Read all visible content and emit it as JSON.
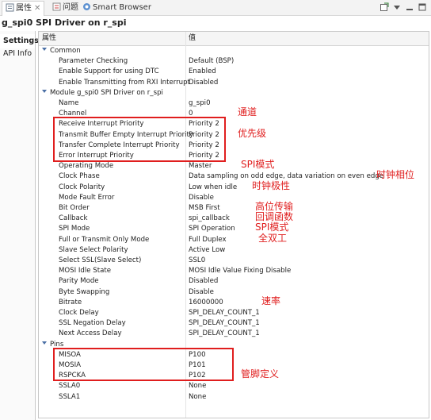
{
  "tabs": [
    {
      "label": "属性",
      "icon": "properties-icon"
    },
    {
      "label": "问题",
      "icon": "problems-icon"
    },
    {
      "label": "Smart Browser",
      "icon": "smart-browser-icon"
    }
  ],
  "title": "g_spi0 SPI Driver on r_spi",
  "side_tabs": [
    "Settings",
    "API Info"
  ],
  "columns": {
    "property": "属性",
    "value": "值"
  },
  "rows": [
    {
      "type": "group",
      "k": "Common"
    },
    {
      "k": "Parameter Checking",
      "v": "Default (BSP)"
    },
    {
      "k": "Enable Support for using DTC",
      "v": "Enabled"
    },
    {
      "k": "Enable Transmitting from RXI Interrupt",
      "v": "Disabled"
    },
    {
      "type": "group",
      "k": "Module g_spi0 SPI Driver on r_spi"
    },
    {
      "k": "Name",
      "v": "g_spi0"
    },
    {
      "k": "Channel",
      "v": "0"
    },
    {
      "k": "Receive Interrupt Priority",
      "v": "Priority 2"
    },
    {
      "k": "Transmit Buffer Empty Interrupt Priority",
      "v": "Priority 2"
    },
    {
      "k": "Transfer Complete Interrupt Priority",
      "v": "Priority 2"
    },
    {
      "k": "Error Interrupt Priority",
      "v": "Priority 2"
    },
    {
      "k": "Operating Mode",
      "v": "Master"
    },
    {
      "k": "Clock Phase",
      "v": "Data sampling on odd edge, data variation on even edge"
    },
    {
      "k": "Clock Polarity",
      "v": "Low when idle"
    },
    {
      "k": "Mode Fault Error",
      "v": "Disable"
    },
    {
      "k": "Bit Order",
      "v": "MSB First"
    },
    {
      "k": "Callback",
      "v": "spi_callback"
    },
    {
      "k": "SPI Mode",
      "v": "SPI Operation"
    },
    {
      "k": "Full or Transmit Only Mode",
      "v": "Full Duplex"
    },
    {
      "k": "Slave Select Polarity",
      "v": "Active Low"
    },
    {
      "k": "Select SSL(Slave Select)",
      "v": "SSL0"
    },
    {
      "k": "MOSI Idle State",
      "v": "MOSI Idle Value Fixing Disable"
    },
    {
      "k": "Parity Mode",
      "v": "Disabled"
    },
    {
      "k": "Byte Swapping",
      "v": "Disable"
    },
    {
      "k": "Bitrate",
      "v": "16000000"
    },
    {
      "k": "Clock Delay",
      "v": "SPI_DELAY_COUNT_1"
    },
    {
      "k": "SSL Negation Delay",
      "v": "SPI_DELAY_COUNT_1"
    },
    {
      "k": "Next Access Delay",
      "v": "SPI_DELAY_COUNT_1"
    },
    {
      "type": "group",
      "k": "Pins"
    },
    {
      "k": "MISOA",
      "v": "P100"
    },
    {
      "k": "MOSIA",
      "v": "P101"
    },
    {
      "k": "RSPCKA",
      "v": "P102"
    },
    {
      "k": "SSLA0",
      "v": "None"
    },
    {
      "k": "SSLA1",
      "v": "None"
    }
  ],
  "annotations": [
    {
      "text": "通道",
      "row": 6
    },
    {
      "text": "优先级",
      "row": 8
    },
    {
      "text": "SPI模式",
      "row": 11
    },
    {
      "text": "时钟相位",
      "row": 12
    },
    {
      "text": "时钟极性",
      "row": 13
    },
    {
      "text": "高位传输",
      "row": 15
    },
    {
      "text": "回调函数",
      "row": 16
    },
    {
      "text": "SPI模式",
      "row": 17
    },
    {
      "text": "全双工",
      "row": 18
    },
    {
      "text": "速率",
      "row": 24
    },
    {
      "text": "管脚定义",
      "row": 31
    }
  ],
  "colors": {
    "annotation": "#e01e1e",
    "group_chevron": "#4a6fa5"
  }
}
